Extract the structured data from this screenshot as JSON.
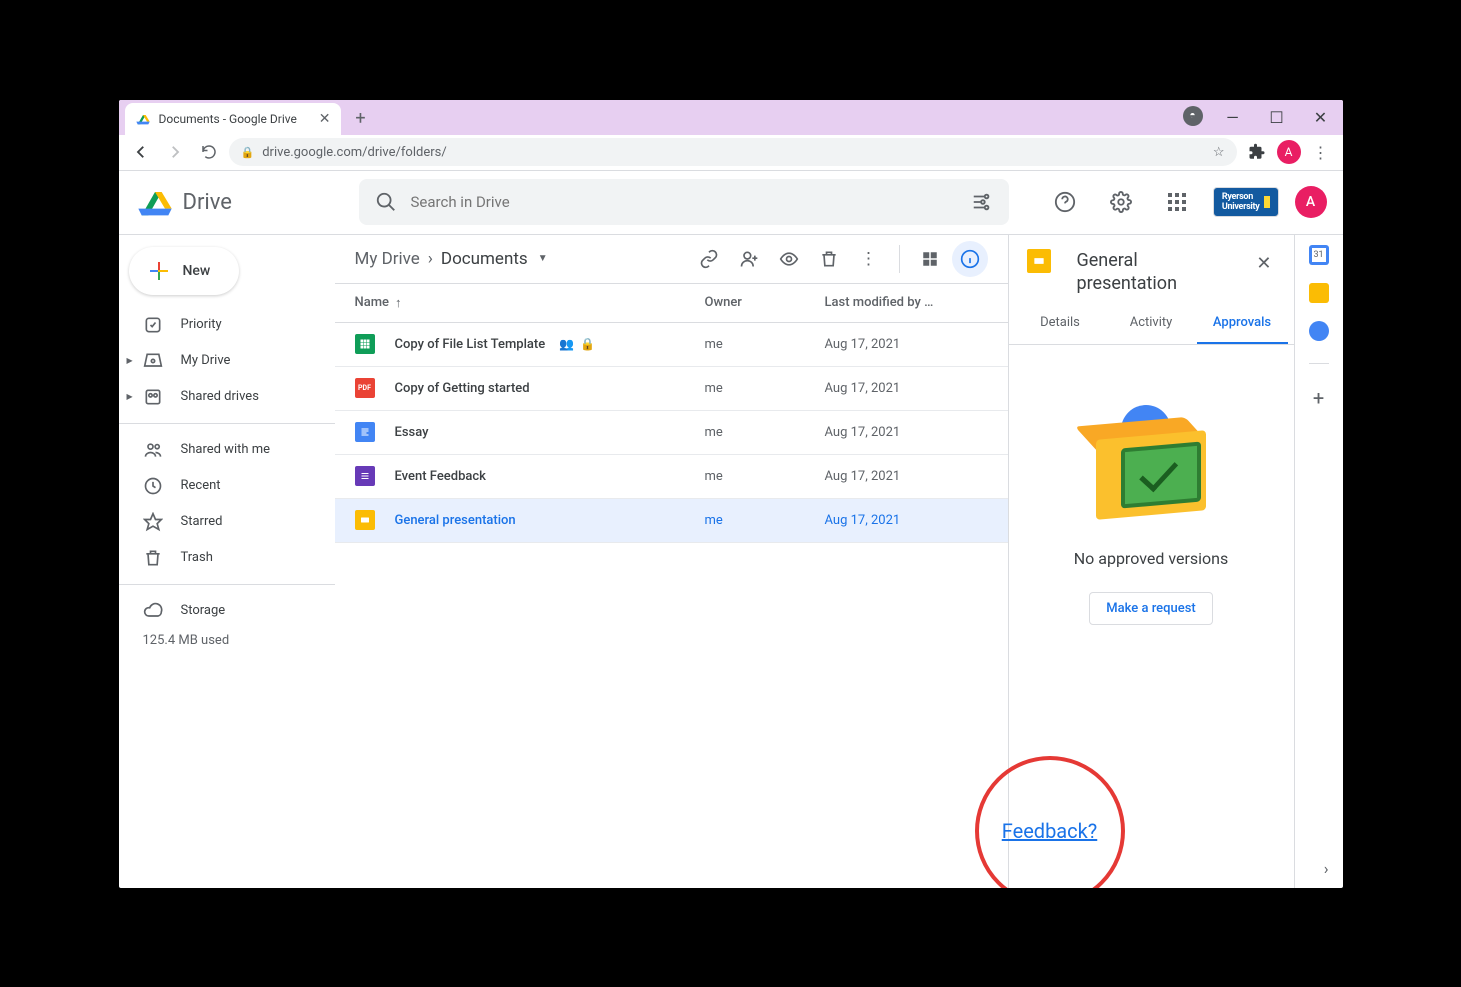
{
  "browser": {
    "tab_title": "Documents - Google Drive",
    "url": "drive.google.com/drive/folders/"
  },
  "app": {
    "name": "Drive",
    "search_placeholder": "Search in Drive",
    "org_label": "Ryerson\nUniversity",
    "avatar_letter": "A"
  },
  "sidebar": {
    "new_label": "New",
    "items": [
      {
        "label": "Priority"
      },
      {
        "label": "My Drive"
      },
      {
        "label": "Shared drives"
      },
      {
        "label": "Shared with me"
      },
      {
        "label": "Recent"
      },
      {
        "label": "Starred"
      },
      {
        "label": "Trash"
      },
      {
        "label": "Storage"
      }
    ],
    "storage_used": "125.4 MB used"
  },
  "breadcrumb": {
    "root": "My Drive",
    "current": "Documents"
  },
  "columns": {
    "name": "Name",
    "owner": "Owner",
    "modified": "Last modified by …"
  },
  "files": [
    {
      "name": "Copy of File List Template",
      "owner": "me",
      "modified": "Aug 17, 2021",
      "icon_bg": "#0f9d58",
      "icon_txt": "",
      "shared": true,
      "locked": true
    },
    {
      "name": "Copy of Getting started",
      "owner": "me",
      "modified": "Aug 17, 2021",
      "icon_bg": "#ea4335",
      "icon_txt": "PDF"
    },
    {
      "name": "Essay",
      "owner": "me",
      "modified": "Aug 17, 2021",
      "icon_bg": "#4285f4",
      "icon_txt": ""
    },
    {
      "name": "Event Feedback",
      "owner": "me",
      "modified": "Aug 17, 2021",
      "icon_bg": "#673ab7",
      "icon_txt": ""
    },
    {
      "name": "General presentation",
      "owner": "me",
      "modified": "Aug 17, 2021",
      "icon_bg": "#fbbc04",
      "icon_txt": "",
      "selected": true
    }
  ],
  "details": {
    "title": "General presentation",
    "tabs": [
      "Details",
      "Activity",
      "Approvals"
    ],
    "active_tab": 2,
    "empty_text": "No approved versions",
    "request_label": "Make a request"
  },
  "feedback_label": "Feedback?"
}
